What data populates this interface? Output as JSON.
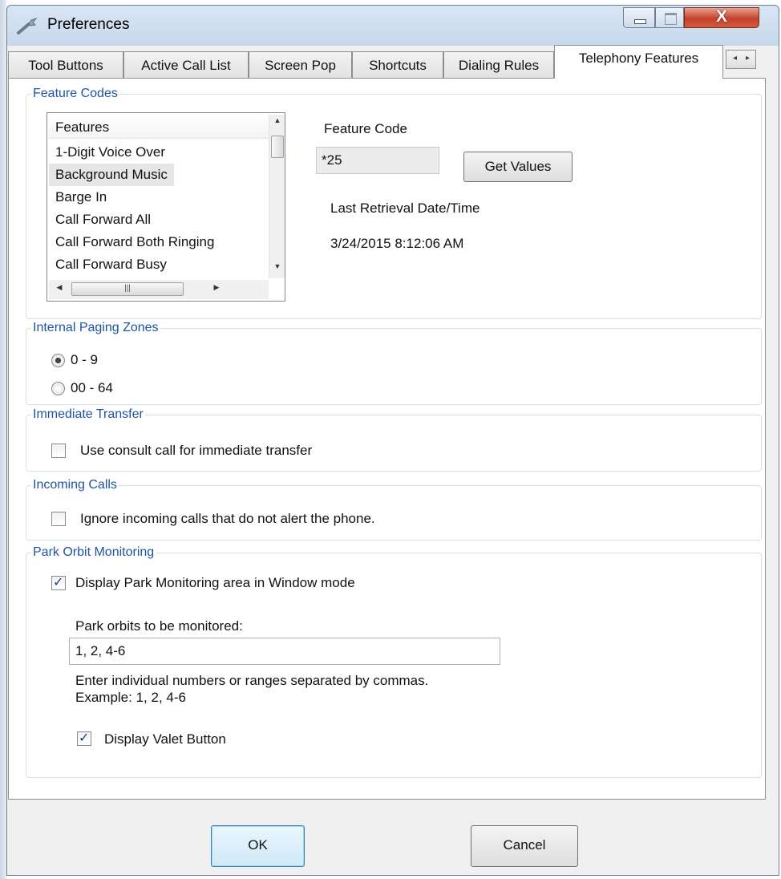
{
  "window": {
    "title": "Preferences",
    "close_label": "X"
  },
  "tabs": [
    {
      "label": "Tool Buttons"
    },
    {
      "label": "Active Call List"
    },
    {
      "label": "Screen Pop"
    },
    {
      "label": "Shortcuts"
    },
    {
      "label": "Dialing Rules"
    },
    {
      "label": "Telephony Features",
      "active": true
    }
  ],
  "feature_codes": {
    "legend": "Feature Codes",
    "list_header": "Features",
    "items": [
      "1-Digit Voice Over",
      "Background Music",
      "Barge In",
      "Call Forward All",
      "Call Forward Both Ringing",
      "Call Forward Busy"
    ],
    "selected_item": "Background Music",
    "feature_code_label": "Feature Code",
    "feature_code_value": "*25",
    "get_values_label": "Get Values",
    "last_retrieval_label": "Last Retrieval Date/Time",
    "last_retrieval_value": "3/24/2015 8:12:06 AM"
  },
  "paging_zones": {
    "legend": "Internal Paging Zones",
    "options": [
      {
        "label": "0 - 9",
        "selected": true
      },
      {
        "label": "00 - 64",
        "selected": false
      }
    ]
  },
  "immediate_transfer": {
    "legend": "Immediate Transfer",
    "checkbox_label": "Use consult call for immediate transfer",
    "checked": false
  },
  "incoming_calls": {
    "legend": "Incoming Calls",
    "checkbox_label": "Ignore incoming calls that do not alert the phone.",
    "checked": false
  },
  "park_orbit": {
    "legend": "Park Orbit Monitoring",
    "display_label": "Display Park Monitoring area in Window mode",
    "display_checked": true,
    "orbits_label": "Park orbits to be monitored:",
    "orbits_value": "1, 2, 4-6",
    "hint_line1": "Enter individual numbers or ranges separated by commas.",
    "hint_line2": "Example: 1, 2, 4-6",
    "valet_label": "Display Valet Button",
    "valet_checked": true
  },
  "footer": {
    "ok_label": "OK",
    "cancel_label": "Cancel"
  },
  "colors": {
    "group_label": "#1f53a5",
    "close_button": "#c5412a"
  },
  "icons": {
    "title": "wrench-icon",
    "check": "check-mark-icon"
  }
}
